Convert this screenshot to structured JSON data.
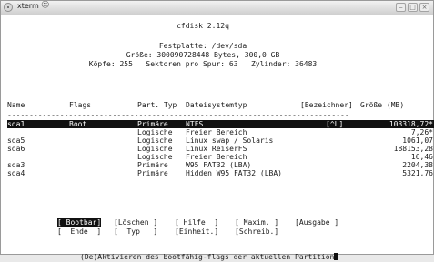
{
  "window": {
    "title": "xterm"
  },
  "header": {
    "program": "cfdisk 2.12q",
    "disk": "Festplatte: /dev/sda",
    "size": "Größe: 300090728448 Bytes, 300,0 GB",
    "geometry": "Köpfe: 255   Sektoren pro Spur: 63   Zylinder: 36483"
  },
  "columns": {
    "name": "Name",
    "flags": "Flags",
    "part_type": "Part. Typ",
    "fs_type": "Dateisystemtyp",
    "label": "[Bezeichner]",
    "size": "Größe (MB)"
  },
  "separator": "------------------------------------------------------------------------------",
  "partitions": [
    {
      "name": "sda1",
      "flags": "Boot",
      "type": "Primäre",
      "fs": "NTFS",
      "label": "[^L]",
      "size": "103318,72*",
      "selected": true
    },
    {
      "name": "",
      "flags": "",
      "type": "Logische",
      "fs": "Freier Bereich",
      "label": "",
      "size": "7,26*",
      "selected": false
    },
    {
      "name": "sda5",
      "flags": "",
      "type": "Logische",
      "fs": "Linux swap / Solaris",
      "label": "",
      "size": "1061,07",
      "selected": false
    },
    {
      "name": "sda6",
      "flags": "",
      "type": "Logische",
      "fs": "Linux ReiserFS",
      "label": "",
      "size": "188153,28",
      "selected": false
    },
    {
      "name": "",
      "flags": "",
      "type": "Logische",
      "fs": "Freier Bereich",
      "label": "",
      "size": "16,46",
      "selected": false
    },
    {
      "name": "sda3",
      "flags": "",
      "type": "Primäre",
      "fs": "W95 FAT32 (LBA)",
      "label": "",
      "size": "2204,38",
      "selected": false
    },
    {
      "name": "sda4",
      "flags": "",
      "type": "Primäre",
      "fs": "Hidden W95 FAT32 (LBA)",
      "label": "",
      "size": "5321,76",
      "selected": false
    }
  ],
  "menu": {
    "bootable": "[ Bootbar]",
    "delete": "[Löschen ]",
    "help": "[ Hilfe  ]",
    "maximize": "[ Maxim. ]",
    "print": "[Ausgabe ]",
    "quit": "[  Ende  ]",
    "type": "[  Typ   ]",
    "units": "[Einheit.]",
    "write": "[Schreib.]"
  },
  "status": "(De)Aktivieren des bootfähig-flags der aktuellen Partition"
}
